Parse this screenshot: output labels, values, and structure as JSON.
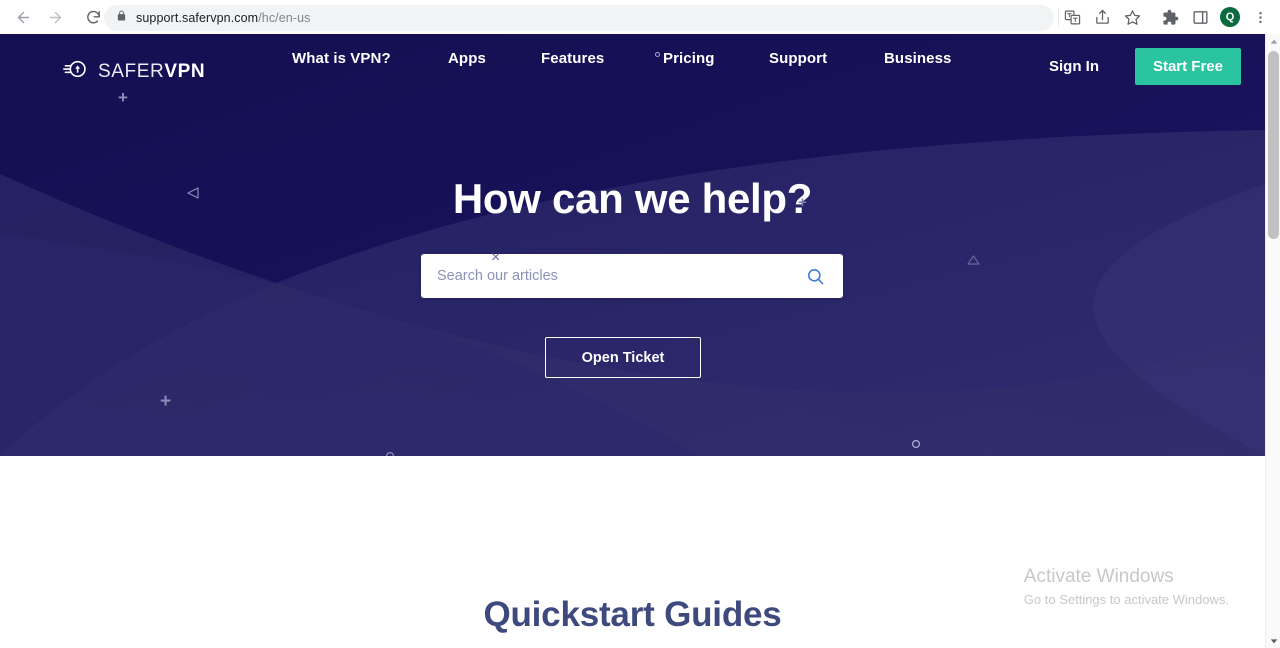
{
  "browser": {
    "back_label": "Back",
    "forward_label": "Forward",
    "reload_label": "Reload",
    "url_host": "support.safervpn.com",
    "url_path": "/hc/en-us",
    "lock_icon": "lock-icon",
    "toolbar_icons": [
      "translate-icon",
      "share-icon",
      "bookmark-star-icon",
      "extensions-puzzle-icon",
      "side-panel-icon"
    ],
    "profile_initial": "Q",
    "menu_label": "Customize and control Google Chrome"
  },
  "site": {
    "logo": {
      "icon": "safervpn-shield-icon",
      "text_light": "SAFER",
      "text_bold": "VPN",
      "plus_mark": "+"
    },
    "nav": [
      {
        "label": "What is VPN?"
      },
      {
        "label": "Apps"
      },
      {
        "label": "Features"
      },
      {
        "label": "Pricing"
      },
      {
        "label": "Support"
      },
      {
        "label": "Business"
      }
    ],
    "sign_in": "Sign In",
    "start_free": "Start Free"
  },
  "hero": {
    "title": "How can we help?",
    "search": {
      "placeholder": "Search our articles",
      "value": "",
      "icon": "search-icon"
    },
    "ticket_button": "Open Ticket",
    "bg_dark": "#17125a",
    "bg_light": "#2f2b6b"
  },
  "lower": {
    "quickstart_title": "Quickstart Guides"
  },
  "watermark": {
    "title": "Activate Windows",
    "subtitle": "Go to Settings to activate Windows."
  },
  "colors": {
    "accent_green": "#2bc4a0",
    "heading_navy": "#3e4a7e",
    "hero_navy": "#17125a"
  }
}
